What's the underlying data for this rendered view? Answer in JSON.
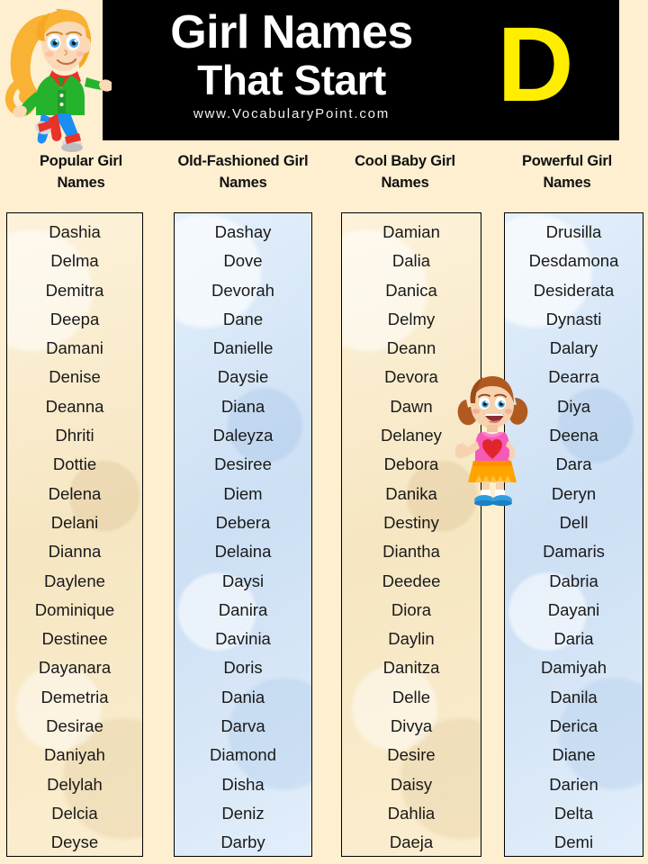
{
  "header": {
    "title_line1": "Girl Names",
    "title_line2": "That Start",
    "letter": "D",
    "website": "www.VocabularyPoint.com",
    "bg_color": "#000000",
    "letter_color": "#ffee00",
    "title_color": "#ffffff"
  },
  "page": {
    "background_color": "#fdefd0",
    "cream_panel_color": "#faeccd",
    "blue_panel_color": "#d6e6f7"
  },
  "mascots": {
    "header_girl": {
      "name": "blonde-girl-illustration",
      "hair_color": "#f9b233",
      "jacket_color": "#25b32e",
      "scarf_color": "#e8332a",
      "pants_color": "#1b8ef2",
      "shoe_color": "#d9d9d9",
      "skin_color": "#fbd9b7"
    },
    "list_girl": {
      "name": "pigtail-girl-illustration",
      "hair_color": "#b05a20",
      "top_color": "#f759b8",
      "heart_color": "#e0262c",
      "skirt_color": "#ffa400",
      "shoe_color": "#2f9de0",
      "sock_color": "#ffffff",
      "skin_color": "#f6d2ae"
    }
  },
  "columns": [
    {
      "heading": "Popular Girl Names",
      "heading_line1": "Popular Girl",
      "heading_line2": "Names",
      "panel_style": "cream",
      "count": 22,
      "names": [
        "Dashia",
        "Delma",
        "Demitra",
        "Deepa",
        "Damani",
        "Denise",
        "Deanna",
        "Dhriti",
        "Dottie",
        "Delena",
        "Delani",
        "Dianna",
        "Daylene",
        "Dominique",
        "Destinee",
        "Dayanara",
        "Demetria",
        "Desirae",
        "Daniyah",
        "Delylah",
        "Delcia",
        "Deyse"
      ]
    },
    {
      "heading": "Old-Fashioned Girl Names",
      "heading_line1": "Old-Fashioned Girl",
      "heading_line2": "Names",
      "panel_style": "blue",
      "count": 22,
      "names": [
        "Dashay",
        "Dove",
        "Devorah",
        "Dane",
        "Danielle",
        "Daysie",
        "Diana",
        "Daleyza",
        "Desiree",
        "Diem",
        "Debera",
        "Delaina",
        "Daysi",
        "Danira",
        "Davinia",
        "Doris",
        "Dania",
        "Darva",
        "Diamond",
        "Disha",
        "Deniz",
        "Darby"
      ]
    },
    {
      "heading": "Cool Baby Girl Names",
      "heading_line1": "Cool Baby Girl",
      "heading_line2": "Names",
      "panel_style": "cream",
      "count": 22,
      "names": [
        "Damian",
        "Dalia",
        "Danica",
        "Delmy",
        "Deann",
        "Devora",
        "Dawn",
        "Delaney",
        "Debora",
        "Danika",
        "Destiny",
        "Diantha",
        "Deedee",
        "Diora",
        "Daylin",
        "Danitza",
        "Delle",
        "Divya",
        "Desire",
        "Daisy",
        "Dahlia",
        "Daeja"
      ]
    },
    {
      "heading": "Powerful Girl Names",
      "heading_line1": "Powerful Girl",
      "heading_line2": "Names",
      "panel_style": "blue",
      "count": 22,
      "names": [
        "Drusilla",
        "Desdamona",
        "Desiderata",
        "Dynasti",
        "Dalary",
        "Dearra",
        "Diya",
        "Deena",
        "Dara",
        "Deryn",
        "Dell",
        "Damaris",
        "Dabria",
        "Dayani",
        "Daria",
        "Damiyah",
        "Danila",
        "Derica",
        "Diane",
        "Darien",
        "Delta",
        "Demi"
      ]
    }
  ]
}
